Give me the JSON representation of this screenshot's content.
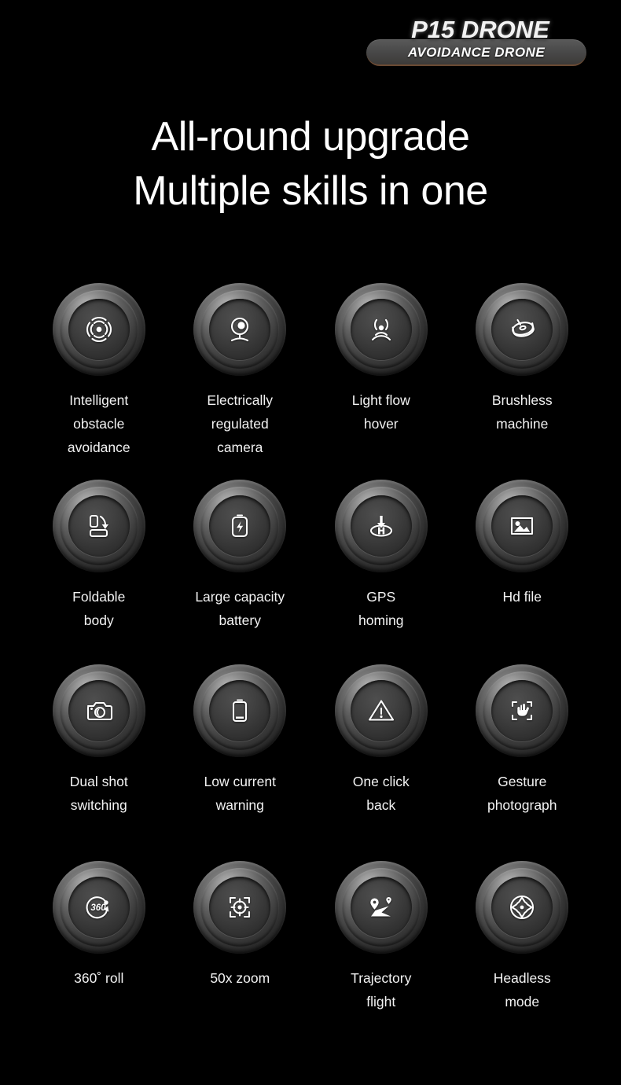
{
  "header": {
    "brand_title": "P15 DRONE",
    "badge_subtitle": "AVOIDANCE DRONE"
  },
  "headline": {
    "line1": "All-round upgrade",
    "line2": "Multiple skills in one"
  },
  "colors": {
    "background": "#000000",
    "text": "#ffffff",
    "badge": "#4a4a4a",
    "badge_accent": "#6b4a33",
    "button_metal_light": "#8d8d8d",
    "button_metal_dark": "#1a1a1a"
  },
  "features": [
    {
      "icon": "obstacle-avoidance-icon",
      "label": "Intelligent\nobstacle\navoidance"
    },
    {
      "icon": "camera-gimbal-icon",
      "label": "Electrically\nregulated\ncamera"
    },
    {
      "icon": "optical-flow-icon",
      "label": "Light flow\nhover"
    },
    {
      "icon": "brushless-motor-icon",
      "label": "Brushless\nmachine"
    },
    {
      "icon": "foldable-body-icon",
      "label": "Foldable\nbody"
    },
    {
      "icon": "battery-charge-icon",
      "label": "Large capacity\nbattery"
    },
    {
      "icon": "gps-homing-icon",
      "label": "GPS\nhoming"
    },
    {
      "icon": "hd-image-icon",
      "label": "Hd file"
    },
    {
      "icon": "camera-icon",
      "label": "Dual shot\nswitching"
    },
    {
      "icon": "low-battery-icon",
      "label": "Low current\nwarning"
    },
    {
      "icon": "warning-triangle-icon",
      "label": "One click\nback"
    },
    {
      "icon": "gesture-hand-icon",
      "label": "Gesture\nphotograph"
    },
    {
      "icon": "360-roll-icon",
      "label": "360˚ roll"
    },
    {
      "icon": "zoom-crosshair-icon",
      "label": "50x zoom"
    },
    {
      "icon": "trajectory-route-icon",
      "label": "Trajectory\nflight"
    },
    {
      "icon": "headless-compass-icon",
      "label": "Headless\nmode"
    }
  ]
}
